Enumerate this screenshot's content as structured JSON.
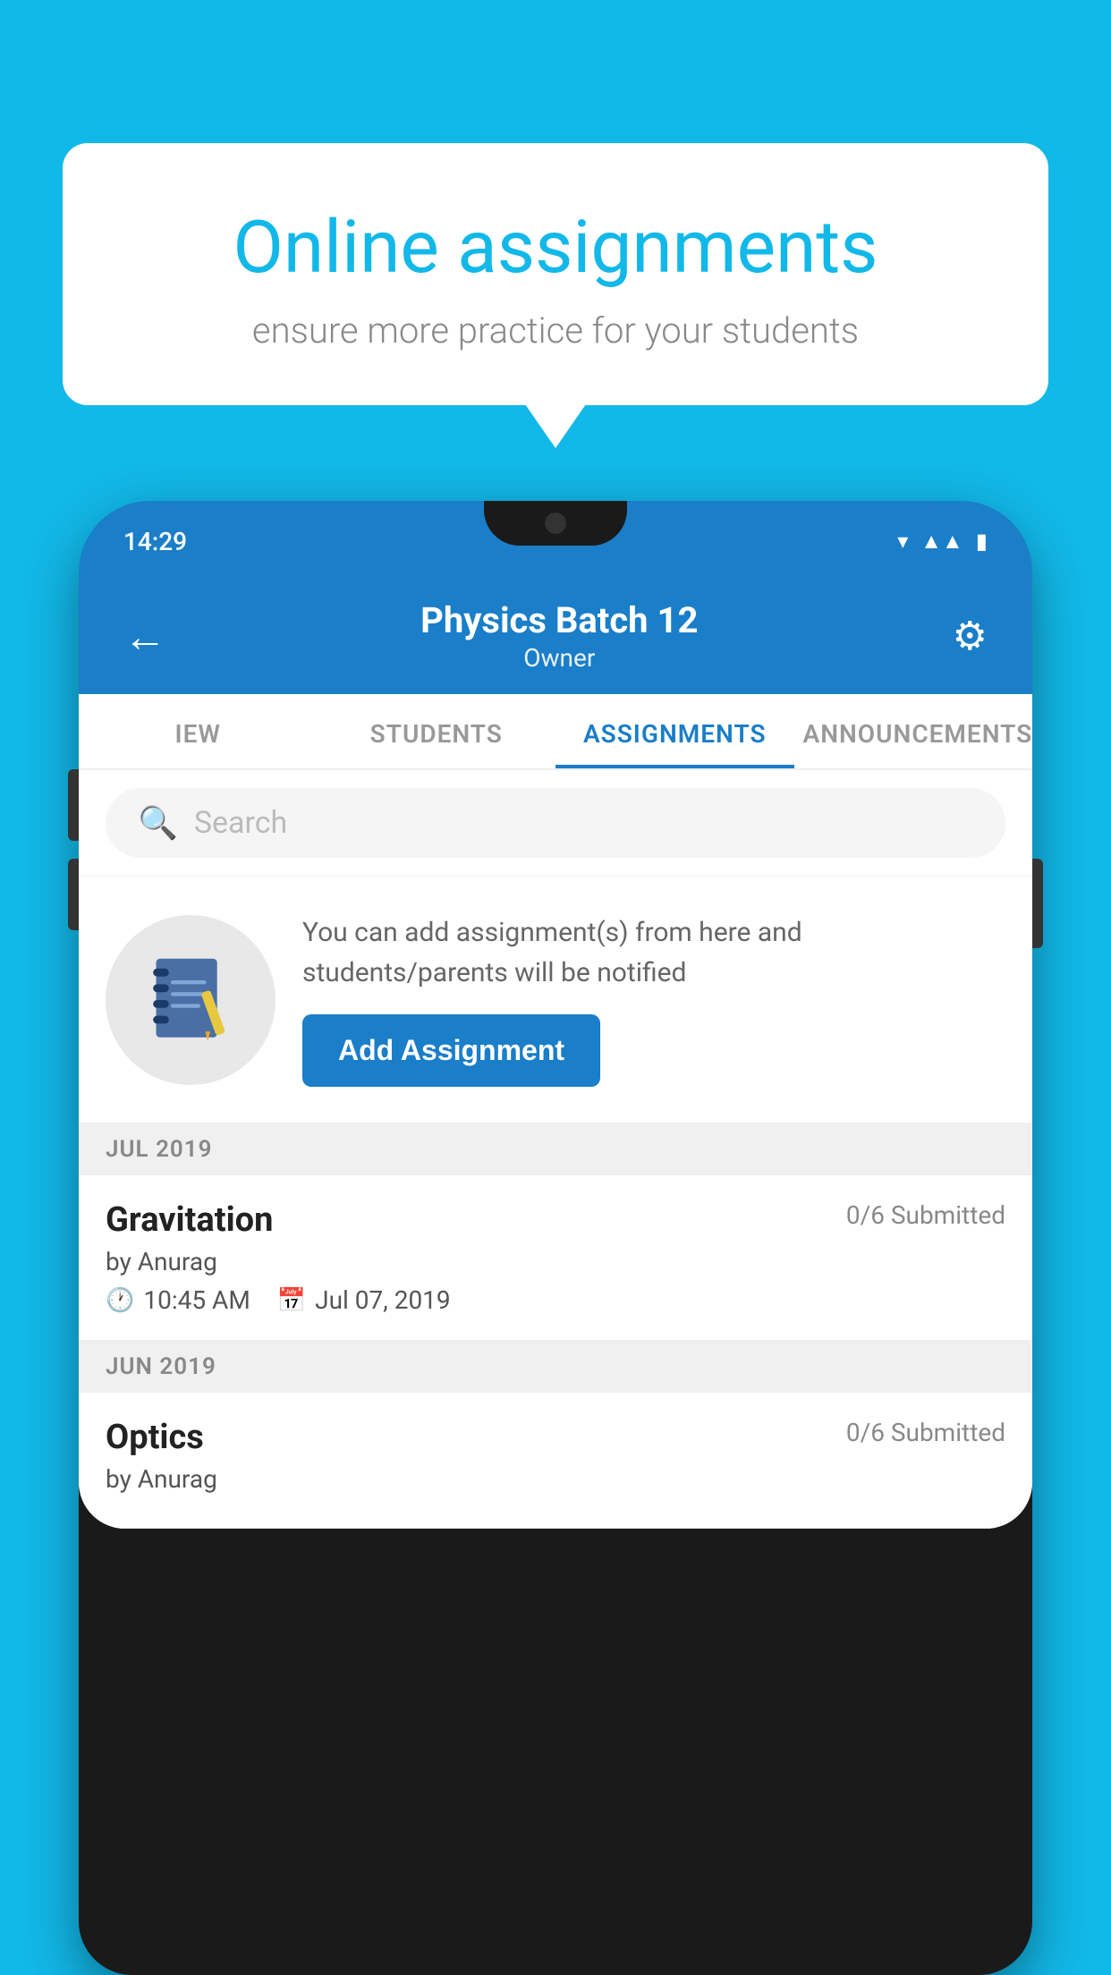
{
  "background_color": "#12b8e8",
  "promo": {
    "title": "Online assignments",
    "subtitle": "ensure more practice for your students"
  },
  "phone": {
    "status_time": "14:29",
    "header": {
      "title": "Physics Batch 12",
      "subtitle": "Owner",
      "back_label": "←",
      "settings_label": "⚙"
    },
    "tabs": [
      {
        "label": "IEW",
        "active": false
      },
      {
        "label": "STUDENTS",
        "active": false
      },
      {
        "label": "ASSIGNMENTS",
        "active": true
      },
      {
        "label": "ANNOUNCEMENTS",
        "active": false
      }
    ],
    "search": {
      "placeholder": "Search"
    },
    "assignment_promo": {
      "description": "You can add assignment(s) from here and students/parents will be notified",
      "button_label": "Add Assignment"
    },
    "assignment_sections": [
      {
        "month": "JUL 2019",
        "assignments": [
          {
            "name": "Gravitation",
            "submitted": "0/6 Submitted",
            "by": "by Anurag",
            "time": "10:45 AM",
            "date": "Jul 07, 2019"
          }
        ]
      },
      {
        "month": "JUN 2019",
        "assignments": [
          {
            "name": "Optics",
            "submitted": "0/6 Submitted",
            "by": "by Anurag",
            "time": "",
            "date": ""
          }
        ]
      }
    ]
  }
}
